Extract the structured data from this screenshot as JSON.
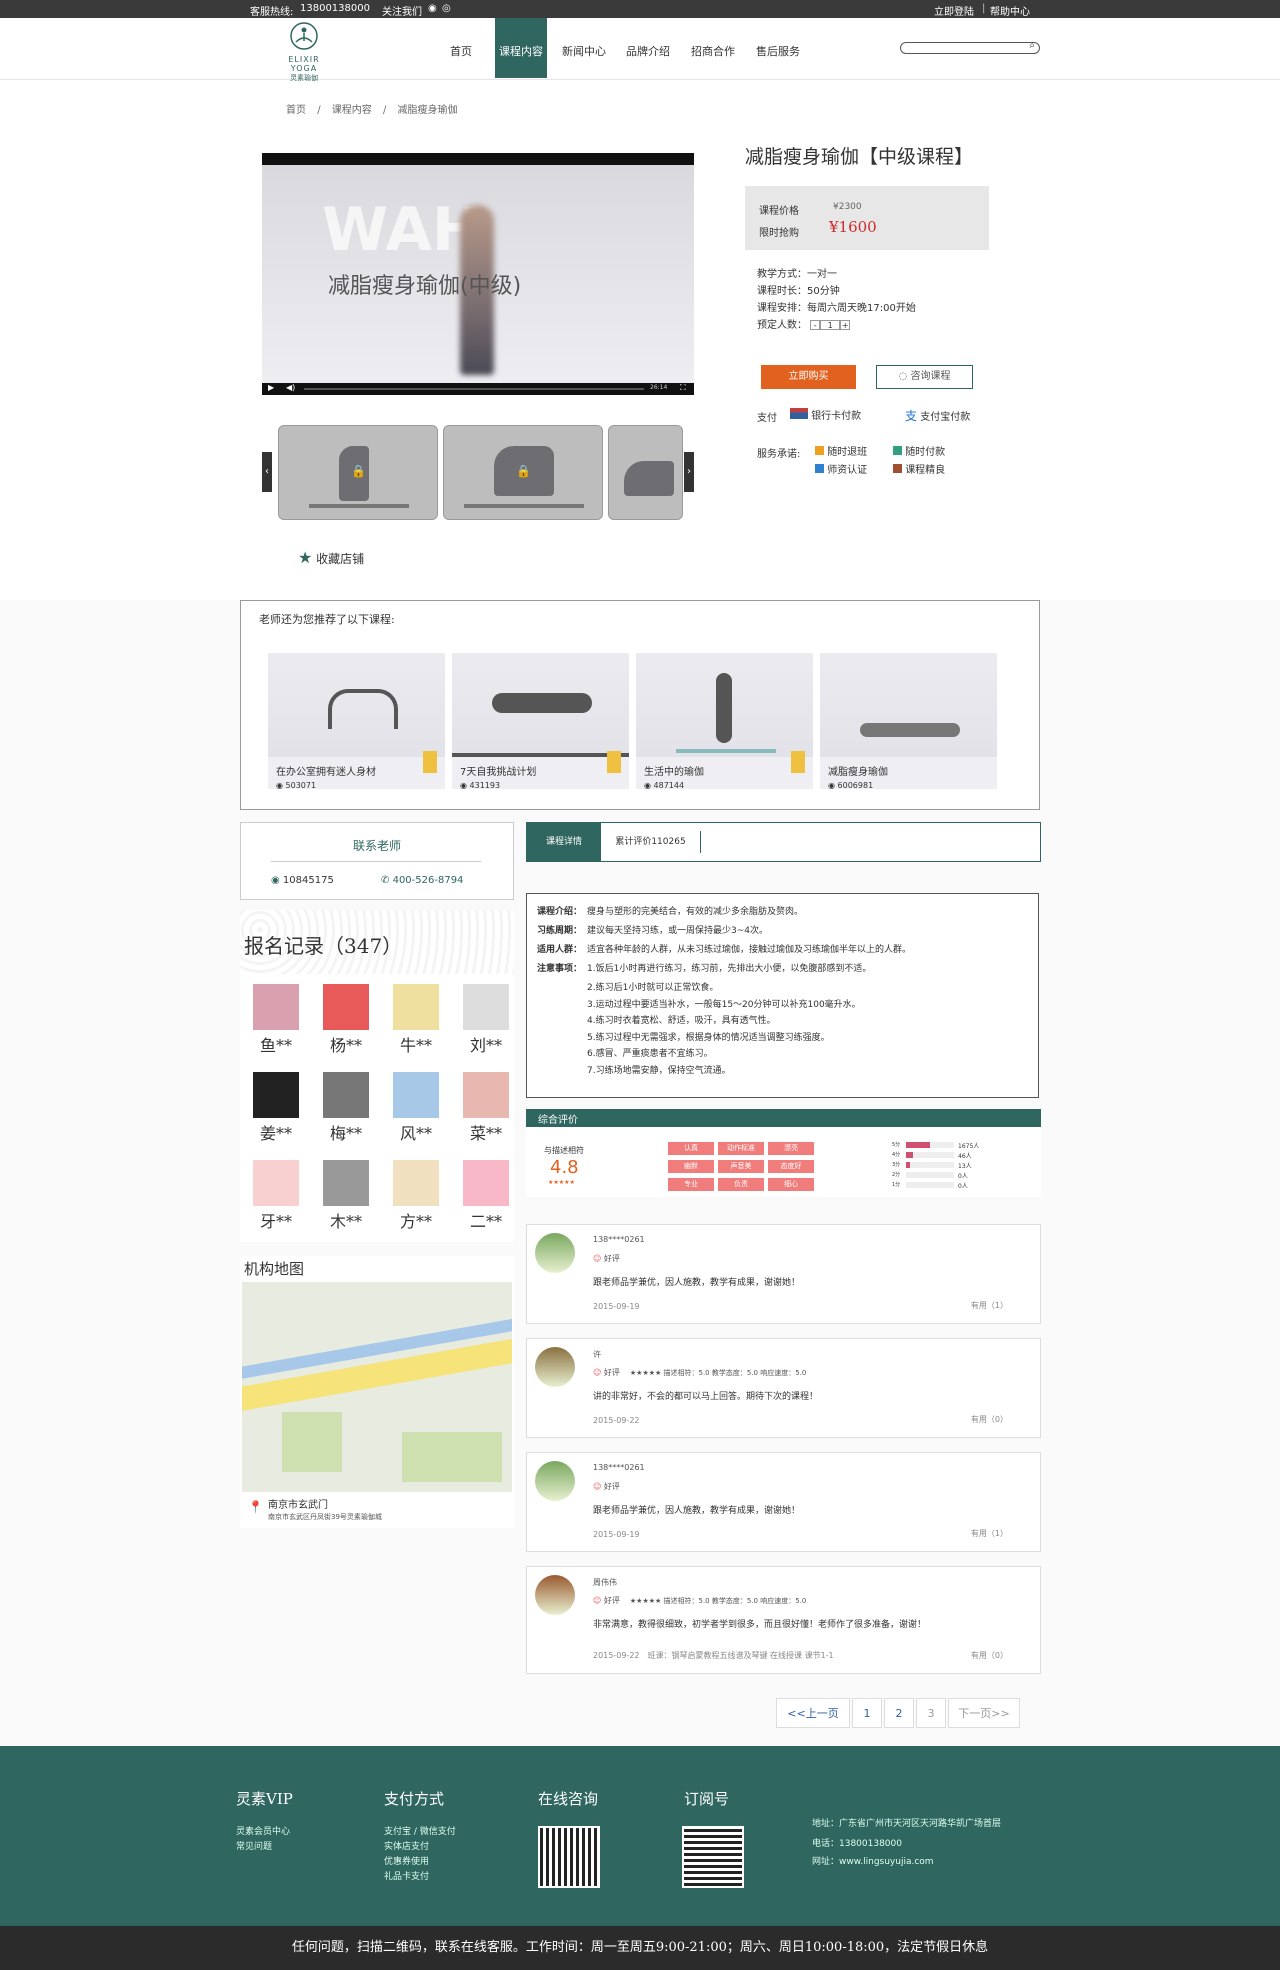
{
  "topbar": {
    "hotline_label": "客服热线:",
    "hotline": "13800138000",
    "follow": "关注我们",
    "login": "立即登陆",
    "help": "帮助中心"
  },
  "brand": {
    "logo_text": "ELIXIR YOGA",
    "logo_cn": "灵素瑜伽"
  },
  "nav": [
    "首页",
    "课程内容",
    "新闻中心",
    "品牌介绍",
    "招商合作",
    "售后服务"
  ],
  "breadcrumb": [
    "首页",
    "/",
    "课程内容",
    "/",
    "减脂瘦身瑜伽"
  ],
  "video": {
    "overlay_title": "减脂瘦身瑜伽(中级)",
    "time": "26:14"
  },
  "collect": "收藏店铺",
  "product": {
    "title": "减脂瘦身瑜伽【中级课程】",
    "price_label": "课程价格",
    "price": "¥2300",
    "sale_label": "限时抢购",
    "sale_price": "¥1600",
    "details": [
      {
        "k": "教学方式：",
        "v": "一对一"
      },
      {
        "k": "课程时长：",
        "v": "50分钟"
      },
      {
        "k": "课程安排：",
        "v": "每周六周天晚17:00开始"
      }
    ],
    "qty_label": "预定人数：",
    "qty": "1",
    "buy": "立即购买",
    "consult": "咨询课程",
    "pay_label": "支付",
    "pay_bank": "银行卡付款",
    "pay_ali": "支付宝付款",
    "service_label": "服务承诺:",
    "services": [
      "随时退班",
      "随时付款",
      "师资认证",
      "课程精良"
    ]
  },
  "recommend": {
    "heading": "老师还为您推荐了以下课程:",
    "items": [
      {
        "title": "在办公室拥有迷人身材",
        "views": "503071"
      },
      {
        "title": "7天自我挑战计划",
        "views": "431193"
      },
      {
        "title": "生活中的瑜伽",
        "views": "487144"
      },
      {
        "title": "减脂瘦身瑜伽",
        "views": "6006981"
      }
    ]
  },
  "contact": {
    "heading": "联系老师",
    "qq": "10845175",
    "phone": "400-526-8794"
  },
  "registration": {
    "heading": "报名记录（347）",
    "names": [
      "鱼**",
      "杨**",
      "牛**",
      "刘**",
      "姜**",
      "梅**",
      "风**",
      "菜**",
      "牙**",
      "木**",
      "方**",
      "二**"
    ]
  },
  "map": {
    "heading": "机构地图",
    "place": "南京市玄武门",
    "address": "南京市玄武区丹凤街39号灵素瑜伽城"
  },
  "tabs": {
    "detail": "课程详情",
    "reviews": "累计评价110265"
  },
  "detail": [
    {
      "k": "课程介绍：",
      "v": "瘦身与塑形的完美结合，有效的减少多余脂肪及赘肉。"
    },
    {
      "k": "习练周期：",
      "v": "建议每天坚持习练，或一周保持最少3~4次。"
    },
    {
      "k": "适用人群：",
      "v": "适宜各种年龄的人群，从未习练过瑜伽，接触过瑜伽及习练瑜伽半年以上的人群。"
    },
    {
      "k": "注意事项：",
      "v": "1.饭后1小时再进行练习，练习前，先排出大小便，以免腹部感到不适。"
    },
    {
      "k": "",
      "v": "2.练习后1小时就可以正常饮食。"
    },
    {
      "k": "",
      "v": "3.运动过程中要适当补水，一般每15～20分钟可以补充100毫升水。"
    },
    {
      "k": "",
      "v": "4.练习时衣着宽松、舒适，吸汗，具有透气性。"
    },
    {
      "k": "",
      "v": "5.练习过程中无需强求，根据身体的情况适当调整习练强度。"
    },
    {
      "k": "",
      "v": "6.感冒、严重痰患者不宜练习。"
    },
    {
      "k": "",
      "v": "7.习练场地需安静，保持空气流通。"
    }
  ],
  "rating": {
    "heading": "综合评价",
    "label": "与描述相符",
    "score": "4.8",
    "tags": [
      "认真",
      "动作标准",
      "漂亮",
      "幽默",
      "声音美",
      "态度好",
      "专业",
      "负责",
      "细心"
    ],
    "bars": [
      {
        "label": "5分",
        "count": "1675人",
        "pct": 0.5
      },
      {
        "label": "4分",
        "count": "46人",
        "pct": 0.15
      },
      {
        "label": "3分",
        "count": "13人",
        "pct": 0.08
      },
      {
        "label": "2分",
        "count": "0人",
        "pct": 0
      },
      {
        "label": "1分",
        "count": "0人",
        "pct": 0
      }
    ]
  },
  "reviews": [
    {
      "name": "138****0261",
      "tag": "好评",
      "scores": "",
      "text": "跟老师品学兼优，因人施教，教学有成果，谢谢她！",
      "date": "2015-09-19",
      "extra": "",
      "useful": "有用（1）"
    },
    {
      "name": "许",
      "tag": "好评",
      "scores": "★★★★★ 描述相符：5.0 教学态度：5.0 响应速度：5.0",
      "text": "讲的非常好，不会的都可以马上回答。期待下次的课程！",
      "date": "2015-09-22",
      "extra": "",
      "useful": "有用（0）"
    },
    {
      "name": "138****0261",
      "tag": "好评",
      "scores": "",
      "text": "跟老师品学兼优，因人施教，教学有成果，谢谢她！",
      "date": "2015-09-19",
      "extra": "",
      "useful": "有用（1）"
    },
    {
      "name": "周伟伟",
      "tag": "好评",
      "scores": "★★★★★ 描述相符：5.0 教学态度：5.0 响应速度：5.0",
      "text": "非常满意，教得很细致，初学者学到很多，而且很好懂！老师作了很多准备，谢谢！",
      "date": "2015-09-22",
      "extra": "班课：钢琴启蒙教程五线谱及琴键   在线授课   课节1-1",
      "useful": "有用（0）"
    }
  ],
  "pagination": {
    "prev": "<<上一页",
    "p1": "1",
    "p2": "2",
    "p3": "3",
    "next": "下一页>>"
  },
  "footer": {
    "vip_head": "灵素VIP",
    "vip_lines": [
      "灵素会员中心",
      "常见问题"
    ],
    "pay_head": "支付方式",
    "pay_lines": [
      "支付宝 / 微信支付",
      "实体店支付",
      "优惠券使用",
      "礼品卡支付"
    ],
    "online_head": "在线咨询",
    "sub_head": "订阅号",
    "address": "地址：广东省广州市天河区天河路华凯广场首层",
    "tel": "电话：13800138000",
    "web": "网址：www.lingsuyujia.com",
    "bottom": "任何问题，扫描二维码，联系在线客服。工作时间：周一至周五9:00-21:00；周六、周日10:00-18:00，法定节假日休息"
  },
  "colors": {
    "brand": "#2f6660",
    "orange": "#e2611f",
    "price_red": "#d0292b",
    "tag_pink": "#f07c7c"
  }
}
